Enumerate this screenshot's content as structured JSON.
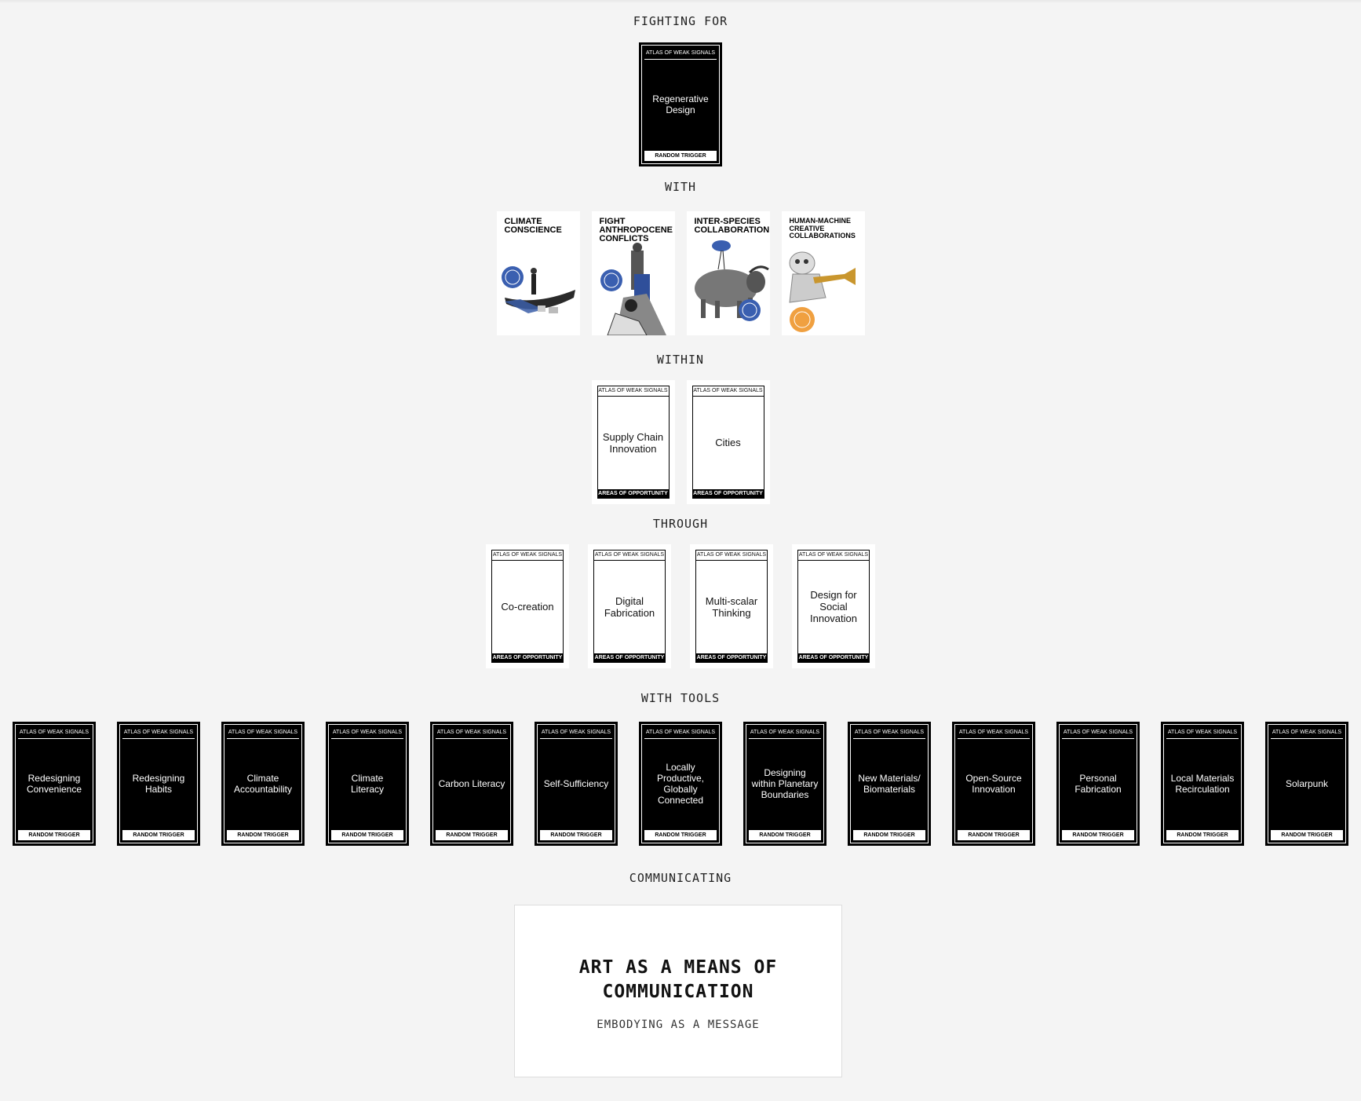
{
  "sections": {
    "fighting_for": "FIGHTING FOR",
    "with": "WITH",
    "within": "WITHIN",
    "through": "THROUGH",
    "with_tools": "WITH TOOLS",
    "communicating": "COMMUNICATING"
  },
  "card_header": "ATLAS OF WEAK SIGNALS",
  "trigger_footer": "RANDOM TRIGGER",
  "opportunity_footer": "AREAS OF OPPORTUNITY",
  "fighting_for_card": {
    "title": "Regenerative Design"
  },
  "with_cards": [
    {
      "title": "CLIMATE CONSCIENCE",
      "badge_color": "#3a5fb0"
    },
    {
      "title": "FIGHT ANTHROPOCENE CONFLICTS",
      "badge_color": "#3a5fb0"
    },
    {
      "title": "INTER-SPECIES COLLABORATION",
      "badge_color": "#3a5fb0"
    },
    {
      "title": "HUMAN-MACHINE CREATIVE COLLABORATIONS",
      "badge_color": "#f0a040"
    }
  ],
  "within_cards": [
    {
      "title": "Supply Chain Innovation"
    },
    {
      "title": "Cities"
    }
  ],
  "through_cards": [
    {
      "title": "Co-creation"
    },
    {
      "title": "Digital Fabrication"
    },
    {
      "title": "Multi-scalar Thinking"
    },
    {
      "title": "Design for Social Innovation"
    }
  ],
  "tool_cards": [
    {
      "title": "Redesigning Convenience"
    },
    {
      "title": "Redesigning Habits"
    },
    {
      "title": "Climate Accountability"
    },
    {
      "title": "Climate Literacy"
    },
    {
      "title": "Carbon Literacy"
    },
    {
      "title": "Self-Sufficiency"
    },
    {
      "title": "Locally Productive, Globally Connected"
    },
    {
      "title": "Designing within Planetary Boundaries"
    },
    {
      "title": "New Materials/ Biomaterials"
    },
    {
      "title": "Open-Source Innovation"
    },
    {
      "title": "Personal Fabrication"
    },
    {
      "title": "Local Materials Recirculation"
    },
    {
      "title": "Solarpunk"
    }
  ],
  "communicating_card": {
    "heading": "ART AS A MEANS OF COMMUNICATION",
    "subheading": "EMBODYING AS A MESSAGE"
  }
}
